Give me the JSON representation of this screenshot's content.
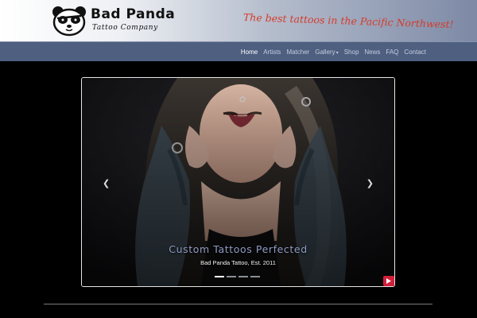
{
  "header": {
    "brand_name": "Bad Panda",
    "brand_sub": "Tattoo Company",
    "tagline": "The best tattoos in the Pacific Northwest!"
  },
  "nav": {
    "home": "Home",
    "artists": "Artists",
    "matcher": "Matcher",
    "gallery": "Gallery",
    "shop": "Shop",
    "news": "News",
    "faq": "FAQ",
    "contact": "Contact"
  },
  "carousel": {
    "title": "Custom Tattoos Perfected",
    "subtitle": "Bad Panda Tattoo, Est. 2011",
    "slide_count": 4,
    "active_slide": 1,
    "prev_icon": "chevron-left-icon",
    "next_icon": "chevron-right-icon",
    "play_icon": "play-icon"
  },
  "colors": {
    "navbar": "#4e5f80",
    "tagline": "#d63a2a",
    "caption_title": "#8f9bc2",
    "play_button": "#d11f3a"
  }
}
